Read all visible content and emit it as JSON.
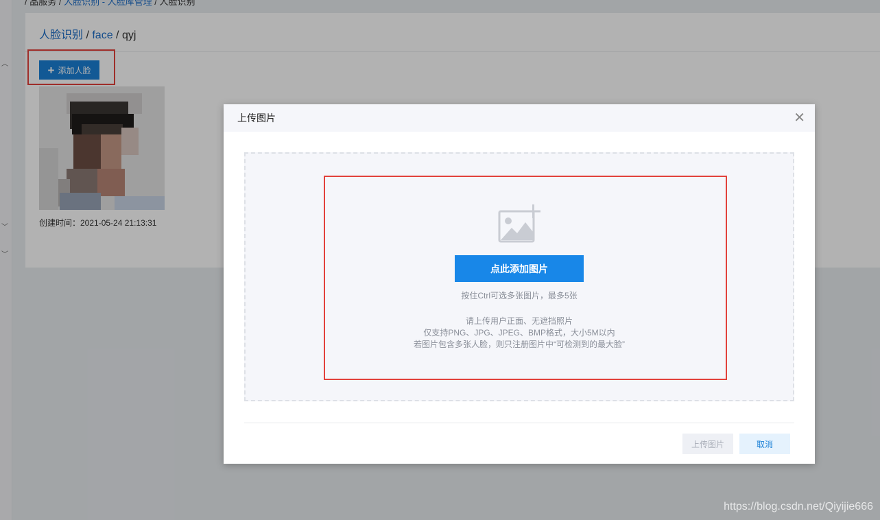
{
  "breadcrumb_top": {
    "prefix": "/ 品服务 /",
    "link1": "人脸识别 - 人脸库管理",
    "sep": " / ",
    "current": "人脸识别"
  },
  "panel": {
    "crumb_root": "人脸识别",
    "crumb_sep1": " / ",
    "crumb_mid": "face",
    "crumb_sep2": " / ",
    "crumb_current": "qyj",
    "add_face_label": "添加人脸",
    "created_label": "创建时间：2021-05-24 21:13:31"
  },
  "modal": {
    "title": "上传图片",
    "pick_button": "点此添加图片",
    "ctrl_hint": "按住Ctrl可选多张图片，最多5张",
    "note1": "请上传用户正面、无遮挡照片",
    "note2": "仅支持PNG、JPG、JPEG、BMP格式，大小5M以内",
    "note3": "若图片包含多张人脸，则只注册图片中“可检测到的最大脸”",
    "upload_button": "上传图片",
    "cancel_button": "取消"
  },
  "watermark": "https://blog.csdn.net/Qiyijie666",
  "icons": {
    "close": "close-icon",
    "plus": "plus-icon",
    "image_add": "image-add-icon"
  },
  "colors": {
    "primary": "#1a80d6",
    "pick_button": "#1887e8",
    "highlight": "#e2413b"
  }
}
